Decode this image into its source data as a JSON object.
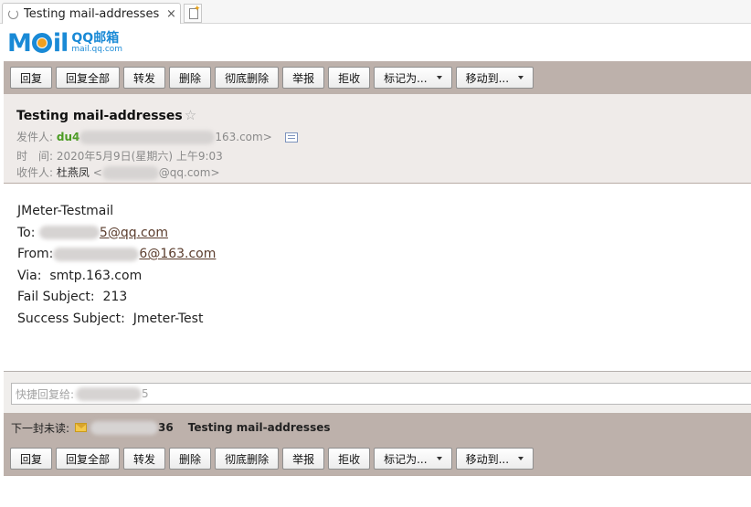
{
  "browser": {
    "tab_title": "Testing mail-addresses -...",
    "tab_close": "×"
  },
  "logo": {
    "mark": "M",
    "mark_tail": "il",
    "brand": "QQ邮箱",
    "domain": "mail.qq.com"
  },
  "toolbar": {
    "reply": "回复",
    "reply_all": "回复全部",
    "forward": "转发",
    "delete": "删除",
    "delete_permanently": "彻底删除",
    "report": "举报",
    "reject": "拒收",
    "mark_as": "标记为...",
    "move_to": "移动到..."
  },
  "mail": {
    "subject": "Testing mail-addresses",
    "star": "☆",
    "from_label": "发件人:",
    "from_name": "du4",
    "from_addr_tail": "163.com>",
    "time_label": "时　间:",
    "time_value": "2020年5月9日(星期六) 上午9:03",
    "to_label": "收件人:",
    "to_name": "杜燕凤",
    "to_addr_open": "<",
    "to_addr_tail": "@qq.com>"
  },
  "body": {
    "line1": "JMeter-Testmail",
    "to_label": "To:",
    "to_addr_tail": "5@qq.com",
    "from_label": "From:",
    "from_addr_tail": "6@163.com",
    "via_label": "Via:",
    "via_value": "smtp.163.com",
    "fail_label": "Fail Subject:",
    "fail_value": "213",
    "success_label": "Success Subject:",
    "success_value": "Jmeter-Test"
  },
  "quick_reply": {
    "label": "快捷回复给:",
    "addr_tail": "5"
  },
  "next_unread": {
    "label": "下一封未读:",
    "sender_tail": "36",
    "subject": "Testing mail-addresses"
  }
}
